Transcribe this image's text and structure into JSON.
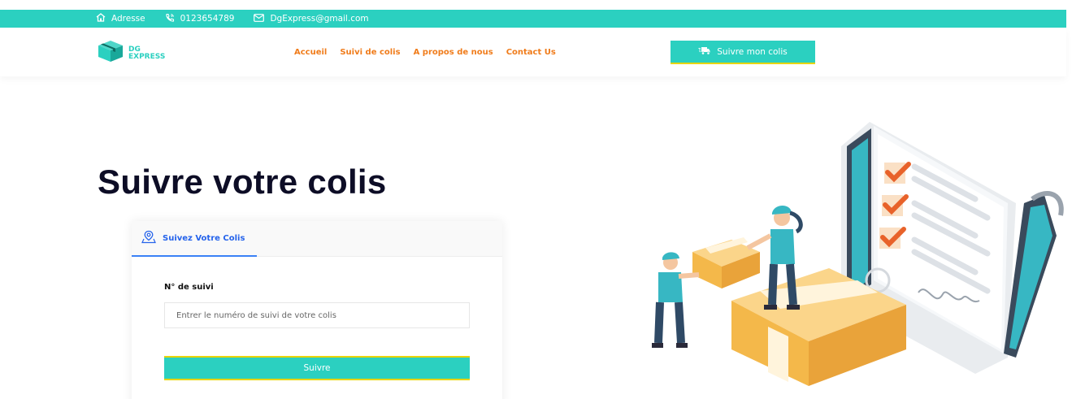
{
  "topbar": {
    "address": "Adresse",
    "phone": "0123654789",
    "email": "DgExpress@gmail.com"
  },
  "header": {
    "logo_line1": "DG",
    "logo_line2": "EXPRESS",
    "nav": [
      "Accueil",
      "Suivi de colis",
      "A propos de nous",
      "Contact Us"
    ],
    "cta": "Suivre mon colis"
  },
  "hero": {
    "title": "Suivre votre colis"
  },
  "tracking_card": {
    "tab_label": "Suivez Votre Colis",
    "field_label": "N° de suivi",
    "input_placeholder": "Entrer le numéro de suivi de votre colis",
    "input_value": "",
    "submit_label": "Suivre"
  },
  "colors": {
    "accent": "#2bd0c0",
    "nav": "#f07c1b",
    "title": "#0d0d26",
    "tab": "#2563eb"
  },
  "icons": [
    "home-icon",
    "phone-icon",
    "mail-icon",
    "truck-icon",
    "location-pin-icon",
    "box-logo-icon"
  ]
}
